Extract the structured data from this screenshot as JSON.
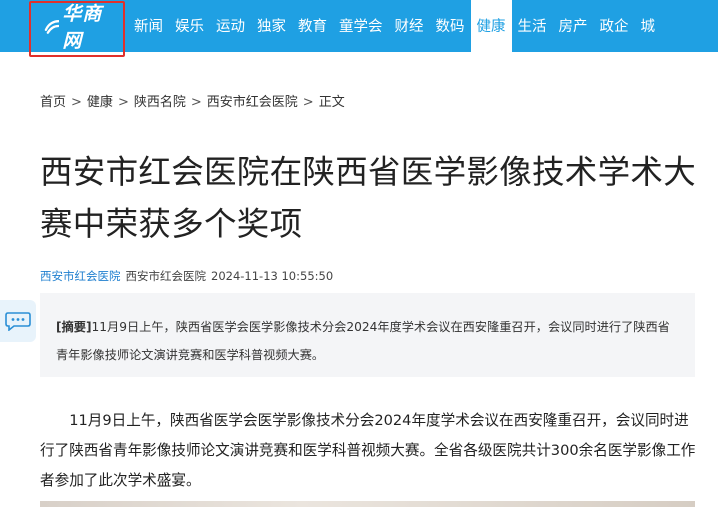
{
  "nav": {
    "logo_text": "华商网",
    "items": [
      {
        "label": "新闻",
        "active": false
      },
      {
        "label": "娱乐",
        "active": false
      },
      {
        "label": "运动",
        "active": false
      },
      {
        "label": "独家",
        "active": false
      },
      {
        "label": "教育",
        "active": false
      },
      {
        "label": "童学会",
        "active": false
      },
      {
        "label": "财经",
        "active": false
      },
      {
        "label": "数码",
        "active": false
      },
      {
        "label": "健康",
        "active": true
      },
      {
        "label": "生活",
        "active": false
      },
      {
        "label": "房产",
        "active": false
      },
      {
        "label": "政企",
        "active": false
      },
      {
        "label": "城",
        "active": false
      }
    ],
    "colors": {
      "bar": "#1fa0e3",
      "highlight_box": "#e0302b"
    }
  },
  "breadcrumb": {
    "items": [
      "首页",
      "健康",
      "陕西名院",
      "西安市红会医院",
      "正文"
    ],
    "separator": ">"
  },
  "article": {
    "title": "西安市红会医院在陕西省医学影像技术学术大赛中荣获多个奖项",
    "source": "西安市红会医院",
    "author": "西安市红会医院",
    "datetime": "2024-11-13 10:55:50",
    "summary_tag": "[摘要]",
    "summary_text": "11月9日上午，陕西省医学会医学影像技术分会2024年度学术会议在西安隆重召开，会议同时进行了陕西省青年影像技师论文演讲竞赛和医学科普视频大赛。",
    "body_paragraph": "11月9日上午，陕西省医学会医学影像技术分会2024年度学术会议在西安隆重召开，会议同时进行了陕西省青年影像技师论文演讲竞赛和医学科普视频大赛。全省各级医院共计300余名医学影像工作者参加了此次学术盛宴。"
  },
  "icons": {
    "chat": "chat-bubble-icon",
    "logo": "huashang-logo-icon"
  }
}
